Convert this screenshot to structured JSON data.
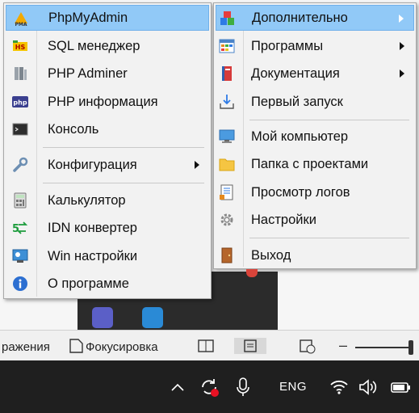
{
  "left_menu": {
    "items": [
      {
        "label": "PhpMyAdmin",
        "icon": "phpmyadmin-icon"
      },
      {
        "label": "SQL менеджер",
        "icon": "sql-manager-icon"
      },
      {
        "label": "PHP Adminer",
        "icon": "adminer-icon"
      },
      {
        "label": "PHP информация",
        "icon": "php-info-icon"
      },
      {
        "label": "Консоль",
        "icon": "console-icon"
      },
      {
        "label": "Конфигурация",
        "icon": "wrench-icon"
      },
      {
        "label": "Калькулятор",
        "icon": "calculator-icon"
      },
      {
        "label": "IDN конвертер",
        "icon": "idn-converter-icon"
      },
      {
        "label": "Win настройки",
        "icon": "win-settings-icon"
      },
      {
        "label": "О программе",
        "icon": "info-icon"
      }
    ]
  },
  "right_menu": {
    "items": [
      {
        "label": "Дополнительно",
        "icon": "additional-icon"
      },
      {
        "label": "Программы",
        "icon": "programs-icon"
      },
      {
        "label": "Документация",
        "icon": "documentation-icon"
      },
      {
        "label": "Первый запуск",
        "icon": "first-run-icon"
      },
      {
        "label": "Мой компьютер",
        "icon": "my-computer-icon"
      },
      {
        "label": "Папка с проектами",
        "icon": "folder-icon"
      },
      {
        "label": "Просмотр логов",
        "icon": "log-viewer-icon"
      },
      {
        "label": "Настройки",
        "icon": "gear-icon"
      },
      {
        "label": "Выход",
        "icon": "exit-door-icon"
      }
    ]
  },
  "status_bar": {
    "left_text": "ражения",
    "focus_text": "Фокусировка"
  },
  "taskbar": {
    "language": "ENG"
  },
  "colors": {
    "highlight": "#91c9f7",
    "menu_bg": "#f2f2f2",
    "taskbar_bg": "#1f1f1f"
  }
}
